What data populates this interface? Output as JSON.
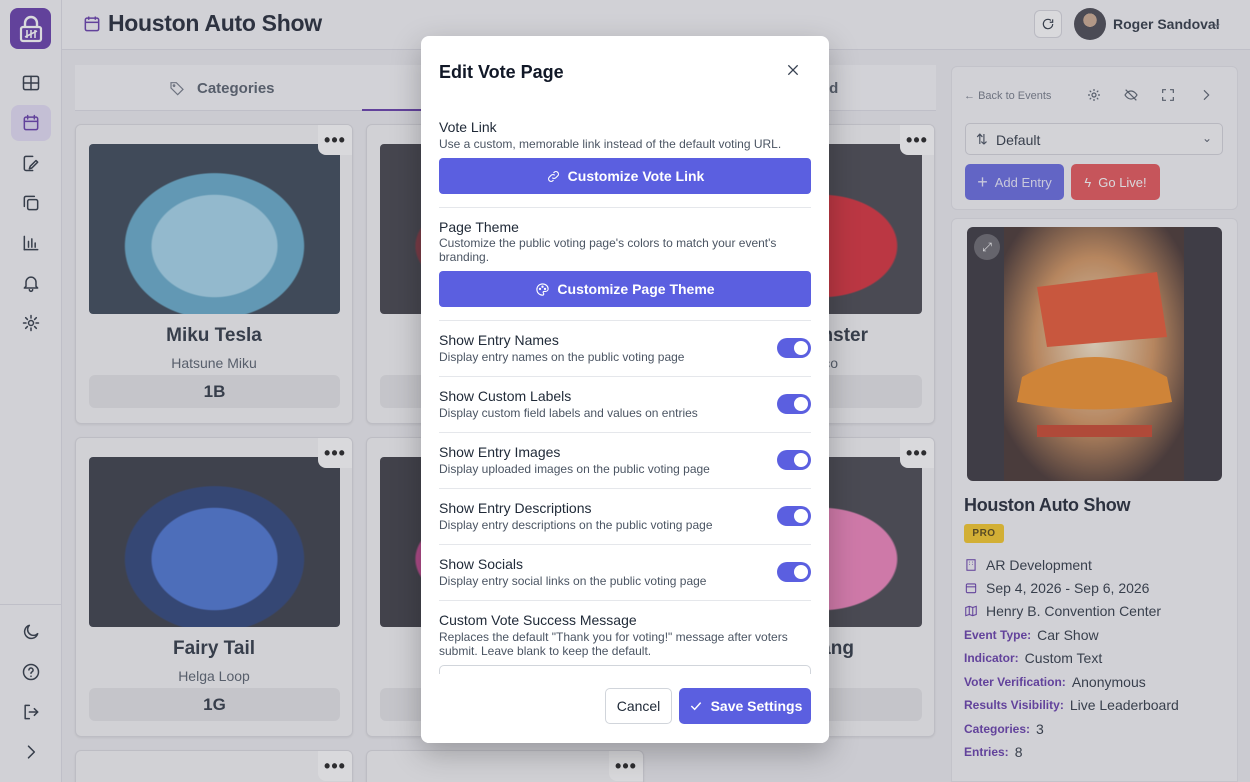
{
  "topbar": {
    "event_title": "Houston Auto Show",
    "user_name": "Roger Sandoval"
  },
  "tabs": {
    "categories": "Categories",
    "leaderboard_partial": "ard"
  },
  "cards": [
    {
      "name": "Miku Tesla",
      "sub": "Hatsune Miku",
      "code": "1B"
    },
    {
      "name": "",
      "sub": "",
      "code": ""
    },
    {
      "name": "nster",
      "sub": "co",
      "code": ""
    },
    {
      "name": "Fairy Tail",
      "sub": "Helga Loop",
      "code": "1G"
    },
    {
      "name": "",
      "sub": "",
      "code": ""
    },
    {
      "name": "ang",
      "sub": "",
      "code": ""
    }
  ],
  "right_panel": {
    "back": "Back to Events",
    "sort_value": "Default",
    "add_entry": "Add Entry",
    "go_live": "Go Live!",
    "event_name": "Houston Auto Show",
    "badge": "PRO",
    "organizer": "AR Development",
    "dates": "Sep 4, 2026 - Sep 6, 2026",
    "venue": "Henry B. Convention Center",
    "event_type_label": "Event Type:",
    "event_type": "Car Show",
    "indicator_label": "Indicator:",
    "indicator": "Custom Text",
    "voter_verification_label": "Voter Verification:",
    "voter_verification": "Anonymous",
    "results_visibility_label": "Results Visibility:",
    "results_visibility": "Live Leaderboard",
    "categories_label": "Categories:",
    "categories": "3",
    "entries_label": "Entries:",
    "entries": "8"
  },
  "modal": {
    "title": "Edit Vote Page",
    "vote_link_title": "Vote Link",
    "vote_link_desc": "Use a custom, memorable link instead of the default voting URL.",
    "vote_link_btn": "Customize Vote Link",
    "theme_title": "Page Theme",
    "theme_desc": "Customize the public voting page's colors to match your event's branding.",
    "theme_btn": "Customize Page Theme",
    "toggles": [
      {
        "title": "Show Entry Names",
        "desc": "Display entry names on the public voting page",
        "on": true
      },
      {
        "title": "Show Custom Labels",
        "desc": "Display custom field labels and values on entries",
        "on": true
      },
      {
        "title": "Show Entry Images",
        "desc": "Display uploaded images on the public voting page",
        "on": true
      },
      {
        "title": "Show Entry Descriptions",
        "desc": "Display entry descriptions on the public voting page",
        "on": true
      },
      {
        "title": "Show Socials",
        "desc": "Display entry social links on the public voting page",
        "on": true
      }
    ],
    "success_title": "Custom Vote Success Message",
    "success_desc": "Replaces the default \"Thank you for voting!\" message after voters submit. Leave blank to keep the default.",
    "cancel": "Cancel",
    "save": "Save Settings"
  },
  "colors": {
    "brand": "#5b2ea6",
    "primary": "#5b5fe0",
    "danger": "#e5484d",
    "badge": "#f5c518"
  }
}
